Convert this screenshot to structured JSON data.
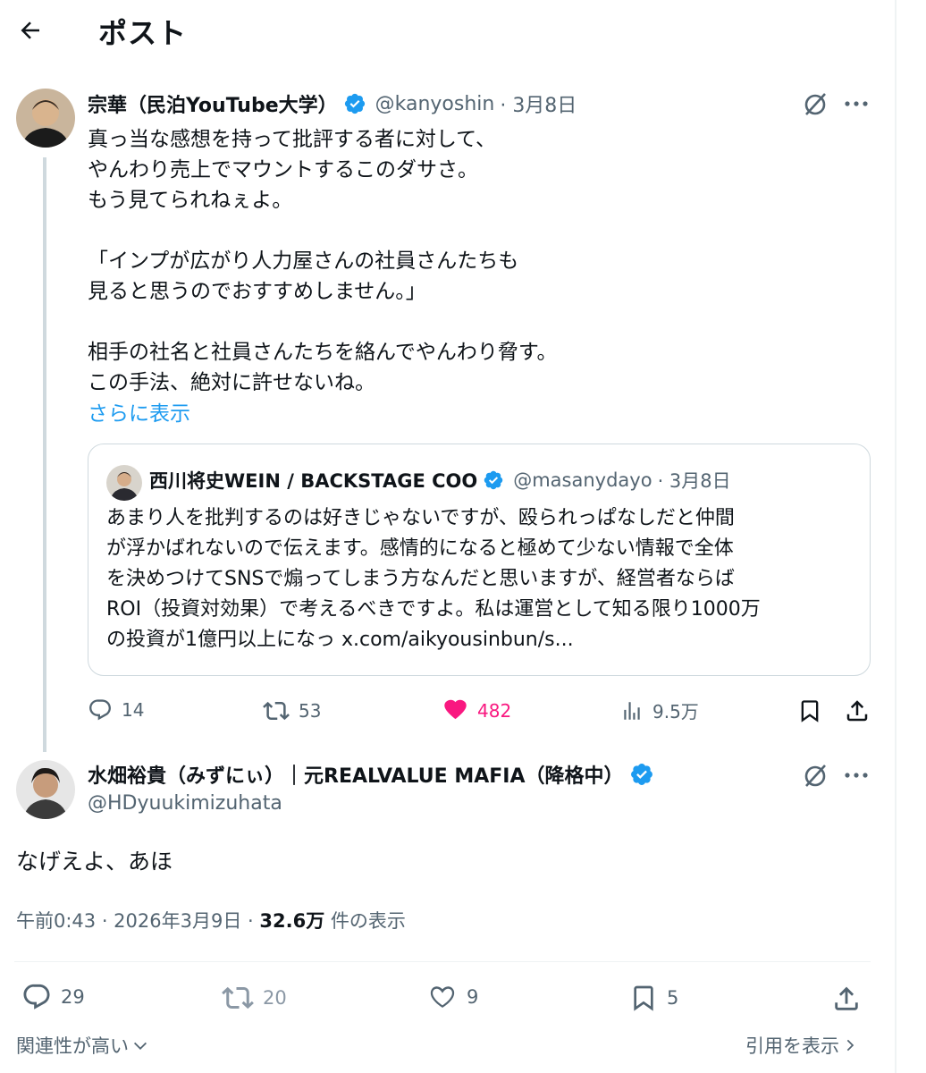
{
  "header": {
    "title": "ポスト"
  },
  "original_post": {
    "display_name": "宗華（民泊YouTube大学）",
    "handle": "@kanyoshin",
    "date": "· 3月8日",
    "body": "真っ当な感想を持って批評する者に対して、\nやんわり売上でマウントするこのダサさ。\nもう見てられねぇよ。\n\n「インプが広がり人力屋さんの社員さんたちも\n見ると思うのでおすすめしません。」\n\n相手の社名と社員さんたちを絡んでやんわり脅す。\nこの手法、絶対に許せないね。",
    "show_more": "さらに表示",
    "quote": {
      "display_name": "西川将史WEIN / BACKSTAGE COO",
      "handle": "@masanydayo",
      "date": "· 3月8日",
      "lines": [
        "あまり人を批判するのは好きじゃないですが、殴られっぱなしだと仲間",
        "が浮かばれないので伝えます。感情的になると極めて少ない情報で全体",
        "を決めつけてSNSで煽ってしまう方なんだと思いますが、経営者ならば",
        "ROI（投資対効果）で考えるべきですよ。私は運営として知る限り1000万",
        "の投資が1億円以上になっ x.com/aikyousinbun/s..."
      ]
    },
    "actions": {
      "replies": "14",
      "reposts": "53",
      "likes": "482",
      "views": "9.5万"
    }
  },
  "reply_post": {
    "display_name": "水畑裕貴（みずにぃ）｜元REALVALUE MAFIA（降格中）",
    "handle": "@HDyuukimizuhata",
    "body": "なげえよ、あほ",
    "time": "午前0:43 · 2026年3月9日 · ",
    "views_count": "32.6万",
    "views_label": " 件の表示",
    "actions": {
      "replies": "29",
      "reposts": "20",
      "likes": "9",
      "bookmarks": "5"
    }
  },
  "footer": {
    "left_link": "関連性が高い",
    "right_link": "引用を表示"
  },
  "colors": {
    "accent": "#1d9bf0",
    "like": "#f91880",
    "muted": "#536471",
    "text": "#0f1419"
  }
}
